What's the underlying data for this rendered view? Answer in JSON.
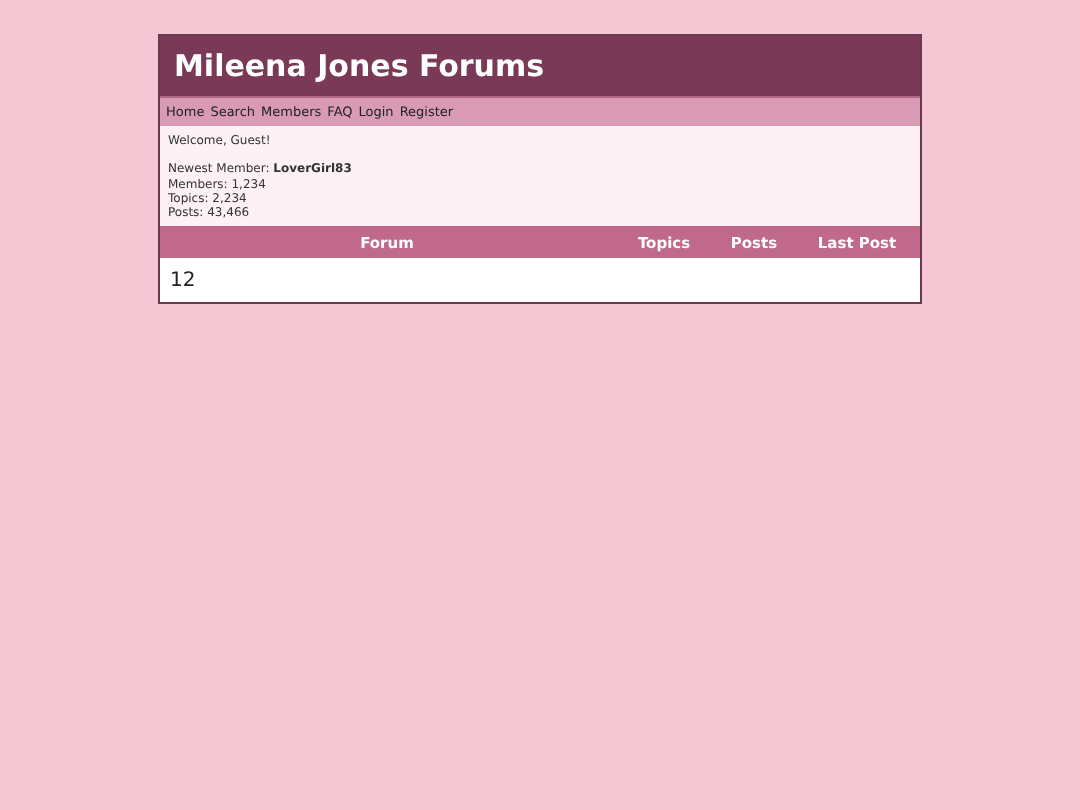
{
  "header": {
    "title": "Mileena Jones Forums"
  },
  "nav": [
    "Home",
    "Search",
    "Members",
    "FAQ",
    "Login",
    "Register"
  ],
  "info": {
    "welcome": "Welcome, Guest!",
    "newest_member": "Newest Member: **LoverGirl83**",
    "stats": [
      "Members: 1,234",
      "Topics: 2,234",
      "Posts: 43,466"
    ]
  },
  "table": {
    "columns": [
      "Forum",
      "Topics",
      "Posts",
      "Last Post"
    ],
    "rows": [
      [
        "12"
      ]
    ]
  }
}
